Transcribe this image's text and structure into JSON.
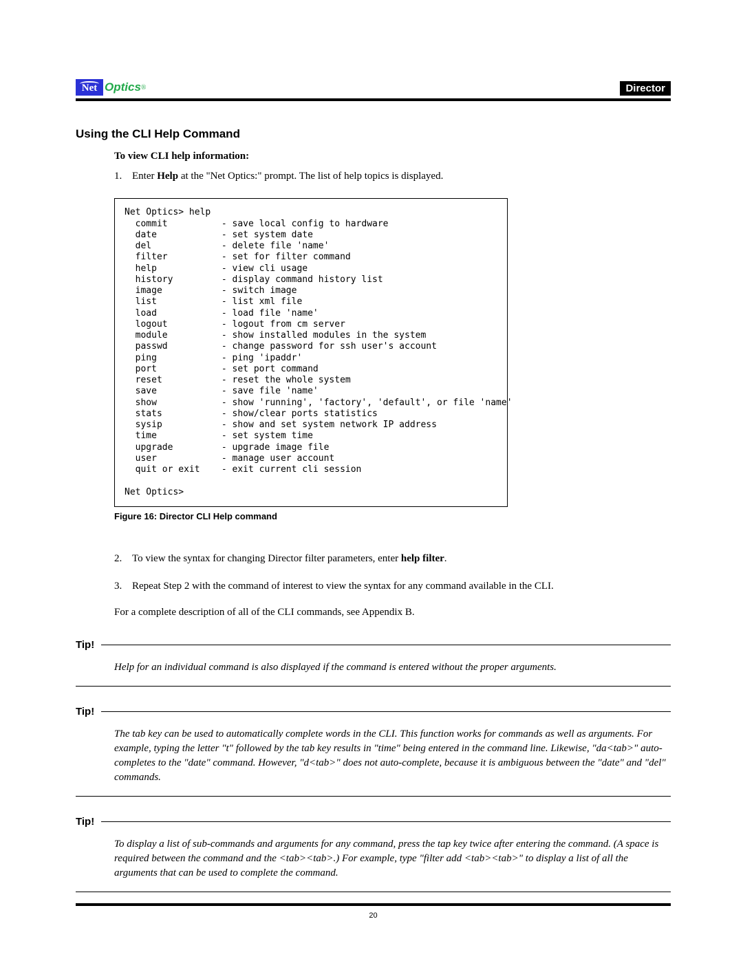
{
  "header": {
    "logo_net": "Net",
    "logo_optics": "Optics",
    "logo_reg": "®",
    "badge": "Director"
  },
  "section_title": "Using the CLI Help Command",
  "subtitle": "To view CLI help information:",
  "step1_num": "1.",
  "step1_pre": "Enter ",
  "step1_bold": "Help",
  "step1_post": " at the \"Net Optics:\" prompt. The list of help topics is displayed.",
  "cli": "Net Optics> help\n  commit          - save local config to hardware\n  date            - set system date\n  del             - delete file 'name'\n  filter          - set for filter command\n  help            - view cli usage\n  history         - display command history list\n  image           - switch image\n  list            - list xml file\n  load            - load file 'name'\n  logout          - logout from cm server\n  module          - show installed modules in the system\n  passwd          - change password for ssh user's account\n  ping            - ping 'ipaddr'\n  port            - set port command\n  reset           - reset the whole system\n  save            - save file 'name'\n  show            - show 'running', 'factory', 'default', or file 'name'\n  stats           - show/clear ports statistics\n  sysip           - show and set system network IP address\n  time            - set system time\n  upgrade         - upgrade image file\n  user            - manage user account\n  quit or exit    - exit current cli session\n\nNet Optics>",
  "figure_caption": "Figure 16: Director CLI Help command",
  "step2_num": "2.",
  "step2_pre": "To view the syntax for changing Director filter parameters, enter ",
  "step2_bold": "help filter",
  "step2_post": ".",
  "step3_num": "3.",
  "step3_text": "Repeat Step 2 with the command of interest to view the syntax for any command available in the CLI.",
  "para_appendix": "For a complete description of all of the CLI commands, see Appendix B.",
  "tip_label": "Tip!",
  "tip1": "Help for an individual command is also displayed if the command is entered without the proper arguments.",
  "tip2": "The tab key can be used to automatically complete words in the CLI. This function works for commands as well as arguments. For example, typing the letter \"t\" followed by the tab key results in \"time\" being entered in the command line. Likewise, \"da<tab>\" auto-completes to the \"date\" command. However, \"d<tab>\" does not auto-complete, because it is ambiguous between the \"date\" and \"del\" commands.",
  "tip3": "To display a list of sub-commands and arguments for any command, press the tap key twice after entering the command. (A space is required between the command and the <tab><tab>.) For example, type \"filter add <tab><tab>\" to display a list of all the arguments that can be used to complete the command.",
  "page_number": "20"
}
